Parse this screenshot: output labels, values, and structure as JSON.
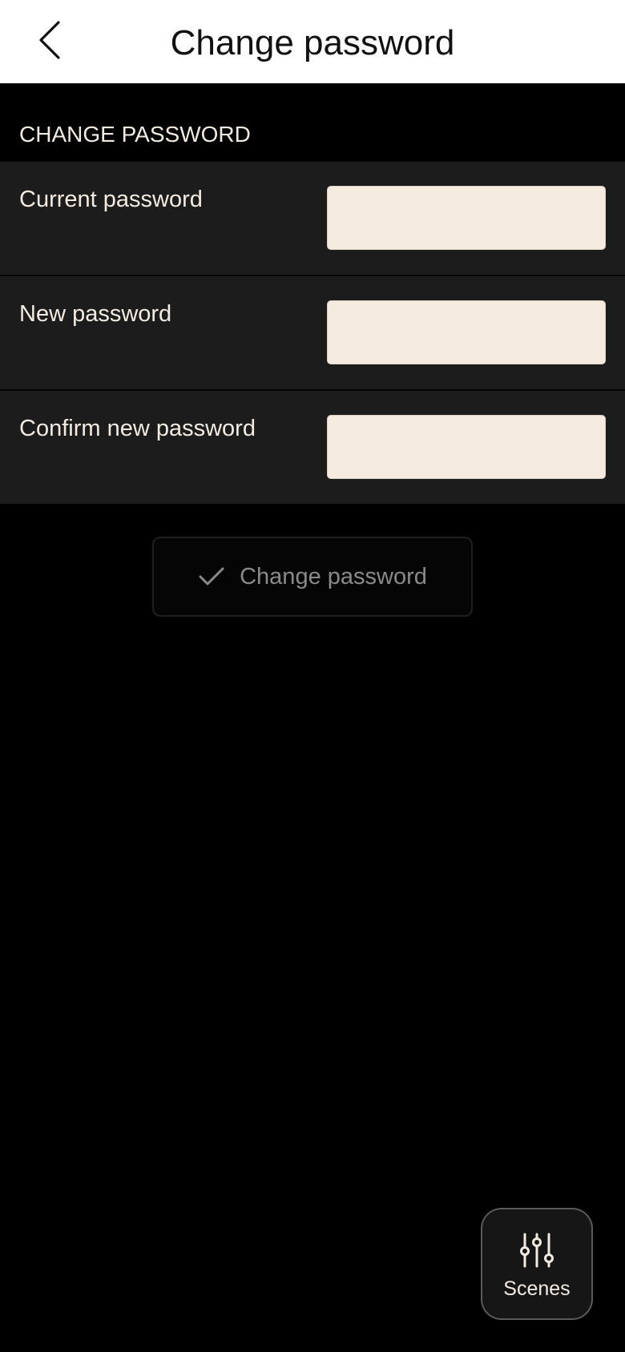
{
  "header": {
    "title": "Change password",
    "back_icon": "chevron-left-icon"
  },
  "section": {
    "label": "CHANGE PASSWORD"
  },
  "form": {
    "rows": [
      {
        "label": "Current password",
        "value": "",
        "placeholder": ""
      },
      {
        "label": "New password",
        "value": "",
        "placeholder": ""
      },
      {
        "label": "Confirm new password",
        "value": "",
        "placeholder": ""
      }
    ]
  },
  "submit": {
    "label": "Change password",
    "icon": "checkmark-icon"
  },
  "scenes": {
    "label": "Scenes",
    "icon": "sliders-icon"
  },
  "colors": {
    "header_bg": "#ffffff",
    "page_bg": "#000000",
    "row_bg": "#1c1c1c",
    "input_bg": "#f5ebdf",
    "text_light": "#f3ebe1",
    "text_muted": "#8a8a8a"
  }
}
